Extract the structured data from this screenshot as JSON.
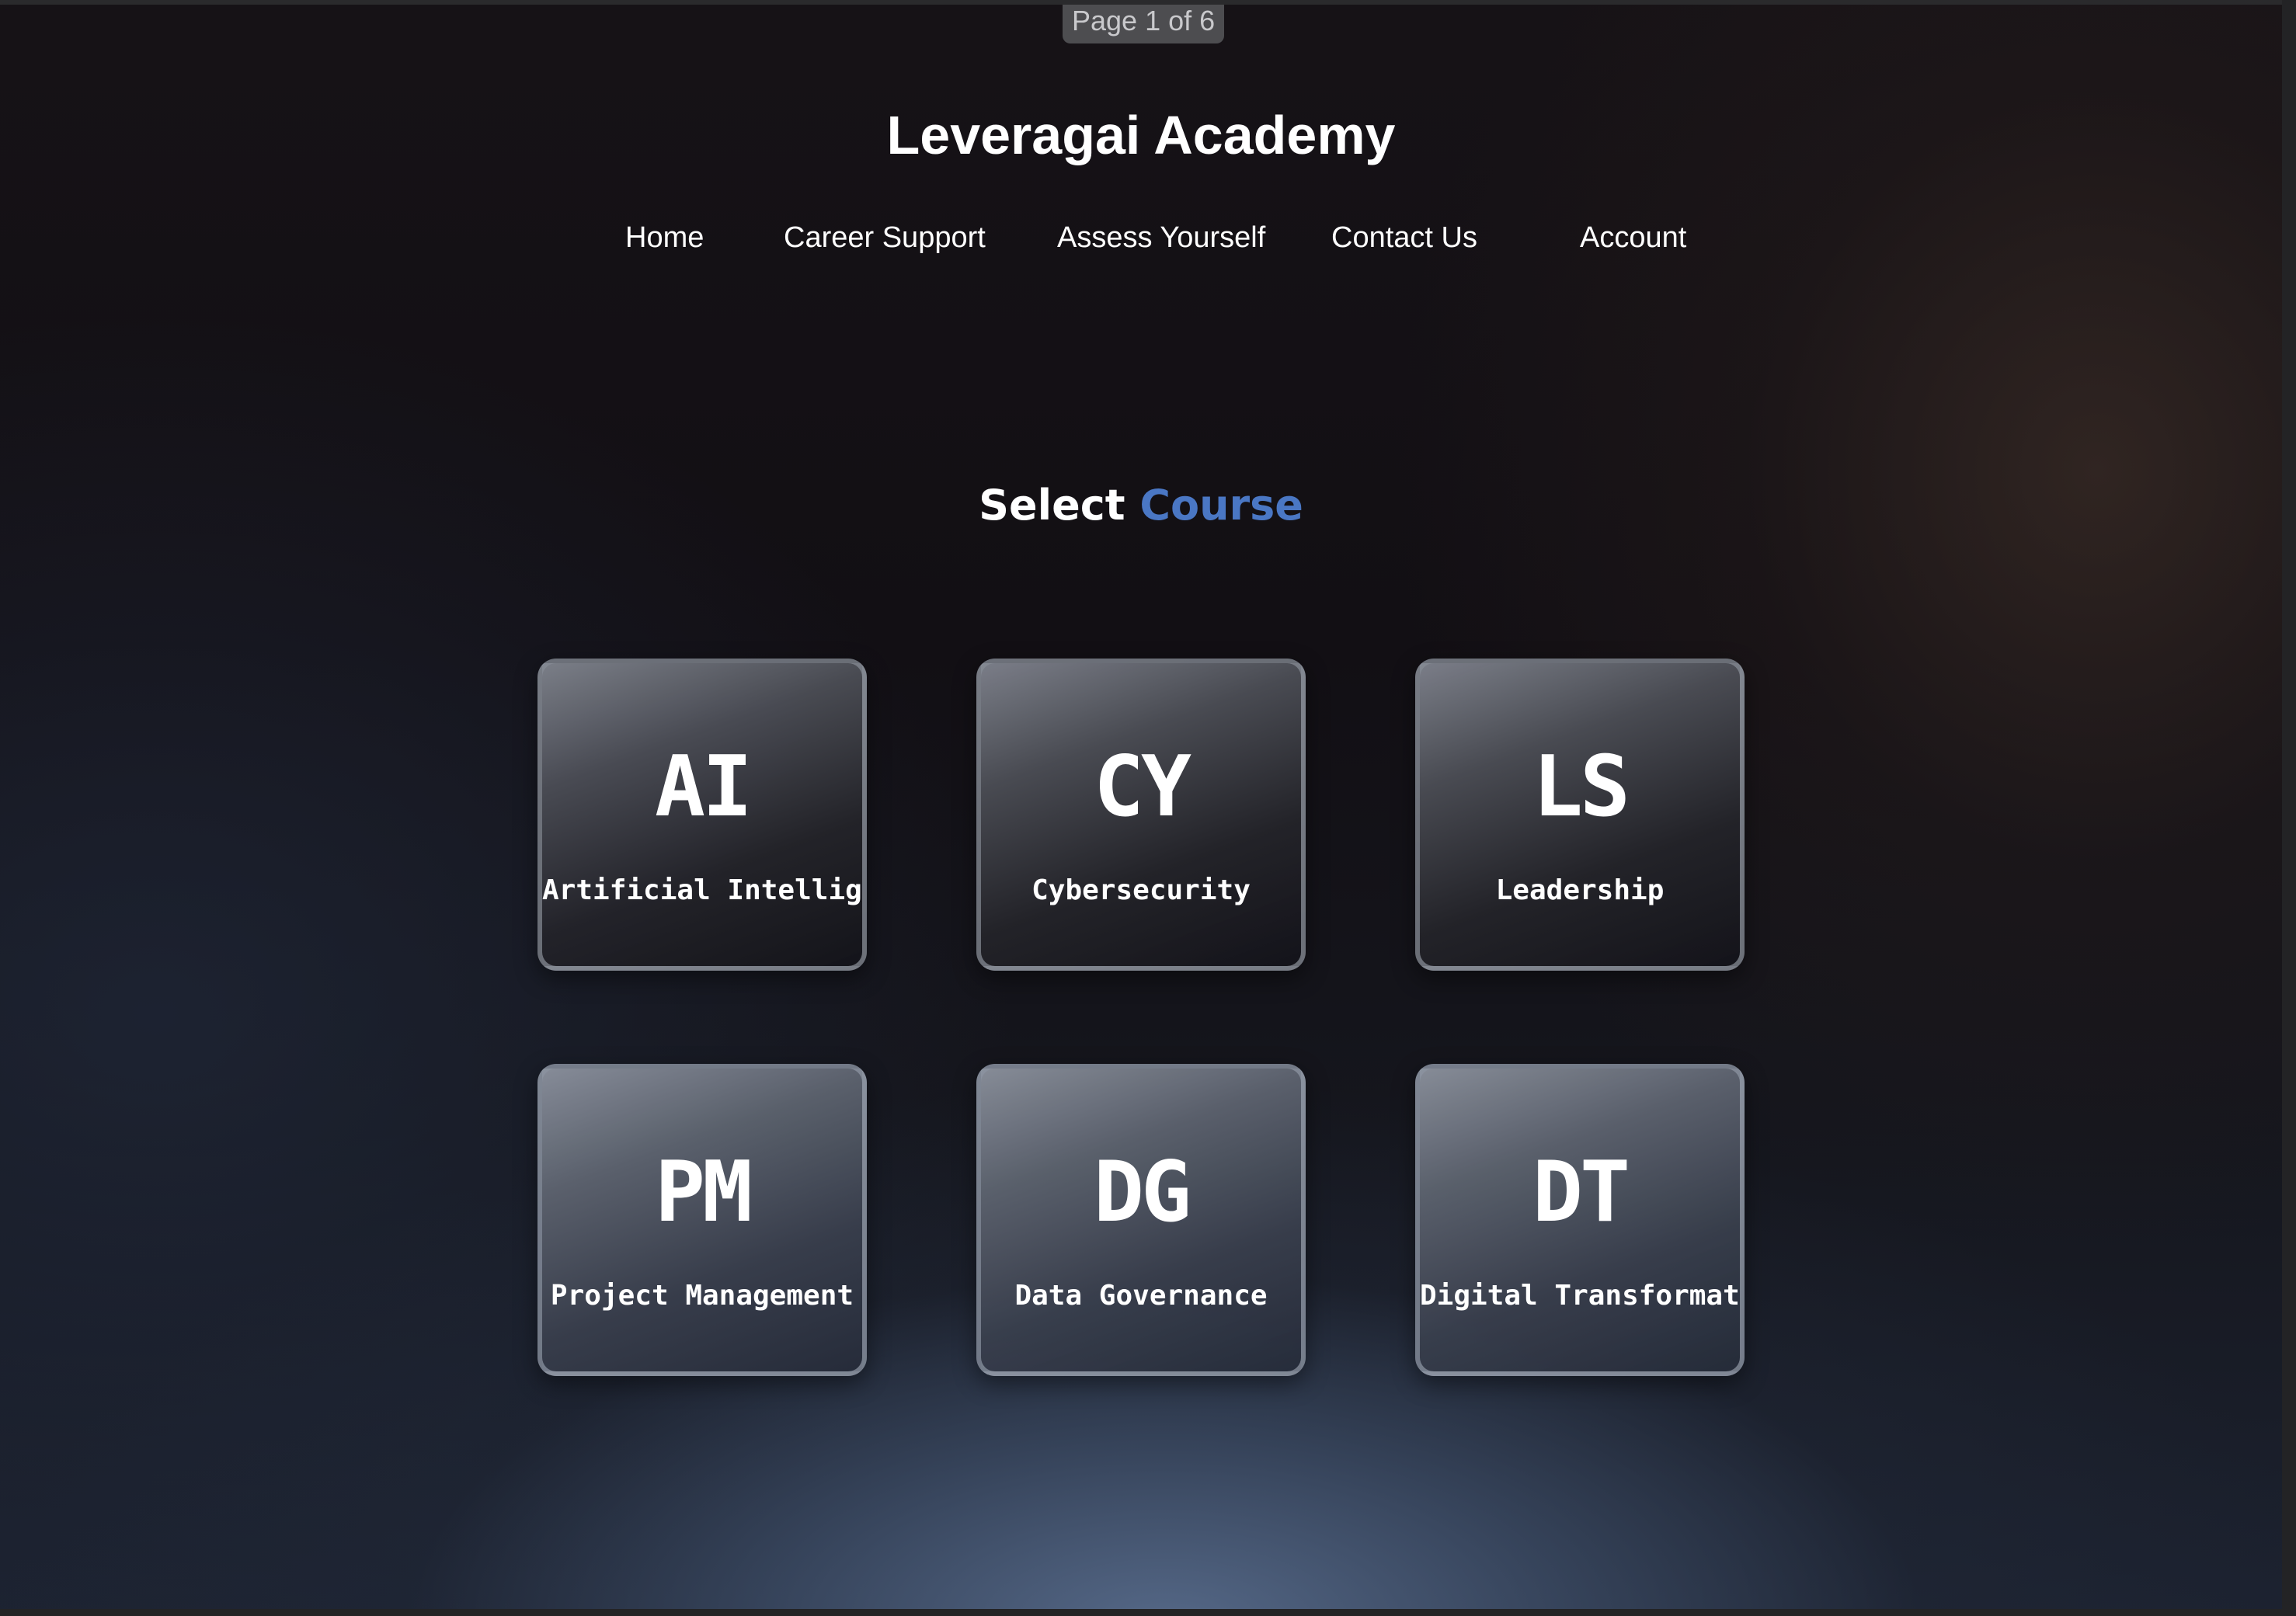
{
  "viewer": {
    "page_indicator": "Page 1 of 6"
  },
  "header": {
    "brand": "Leveragai Academy"
  },
  "nav": {
    "items": [
      {
        "label": "Home"
      },
      {
        "label": "Career Support"
      },
      {
        "label": "Assess Yourself"
      },
      {
        "label": "Contact Us"
      },
      {
        "label": "Account"
      }
    ]
  },
  "courses_section": {
    "title_part1": "Select",
    "title_part2": "Course",
    "accent_color": "#4a77c4",
    "courses": [
      {
        "code": "AI",
        "name": "Artificial Intelligence"
      },
      {
        "code": "CY",
        "name": "Cybersecurity"
      },
      {
        "code": "LS",
        "name": "Leadership"
      },
      {
        "code": "PM",
        "name": "Project Management"
      },
      {
        "code": "DG",
        "name": "Data Governance"
      },
      {
        "code": "DT",
        "name": "Digital Transformation"
      }
    ]
  }
}
